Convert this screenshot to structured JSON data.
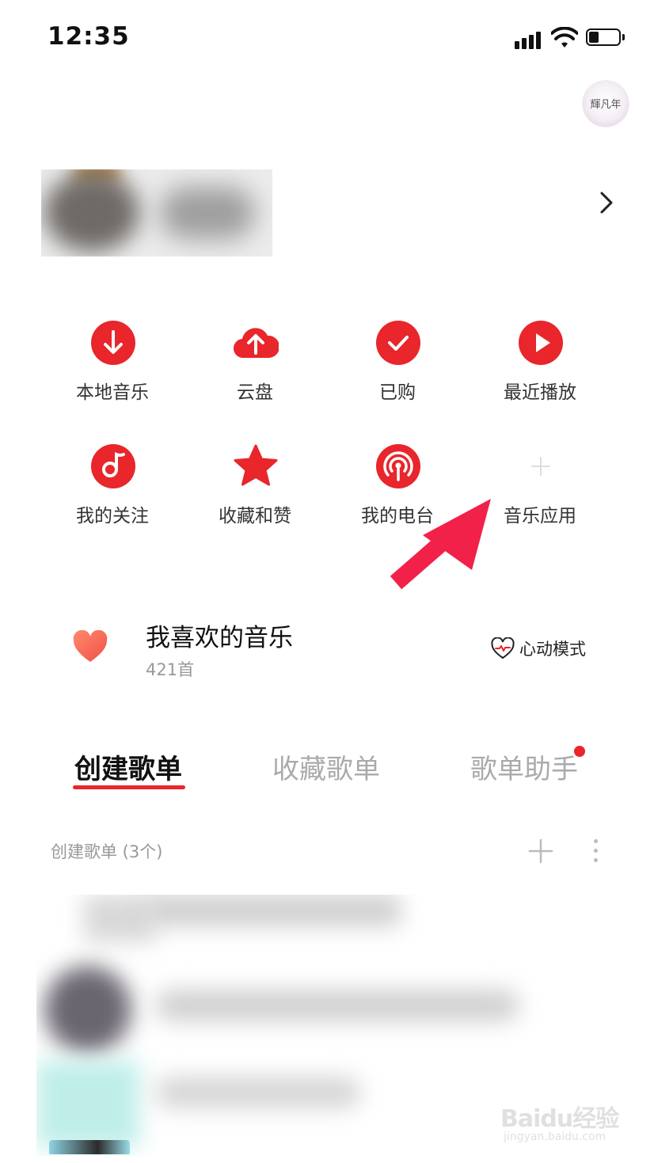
{
  "status_bar": {
    "time": "12:35"
  },
  "profile": {
    "avatar_text": "輝凡年"
  },
  "grid": {
    "row1": [
      {
        "label": "本地音乐",
        "icon": "download-icon"
      },
      {
        "label": "云盘",
        "icon": "cloud-upload-icon"
      },
      {
        "label": "已购",
        "icon": "check-icon"
      },
      {
        "label": "最近播放",
        "icon": "play-icon"
      }
    ],
    "row2": [
      {
        "label": "我的关注",
        "icon": "music-note-icon"
      },
      {
        "label": "收藏和赞",
        "icon": "star-icon"
      },
      {
        "label": "我的电台",
        "icon": "podcast-icon"
      },
      {
        "label": "音乐应用",
        "icon": "plus-icon"
      }
    ]
  },
  "favorite": {
    "title": "我喜欢的音乐",
    "count": "421首",
    "mode_label": "心动模式"
  },
  "tabs": {
    "created": "创建歌单",
    "collected": "收藏歌单",
    "helper": "歌单助手"
  },
  "section": {
    "title": "创建歌单 (3个)"
  },
  "watermark": {
    "main": "Baidu经验",
    "sub": "jingyan.baidu.com"
  },
  "colors": {
    "accent": "#e8262b",
    "muted_text": "#999999"
  }
}
